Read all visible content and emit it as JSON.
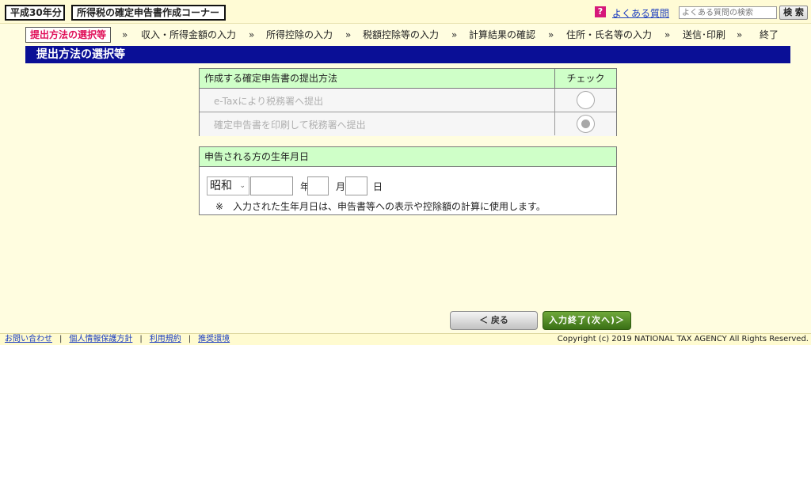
{
  "header": {
    "year_badge": "平成30年分",
    "corner_title": "所得税の確定申告書作成コーナー",
    "faq_icon": "?",
    "faq_link": "よくある質問",
    "faq_search_placeholder": "よくある質問の検索",
    "search_button": "検 索"
  },
  "steps": {
    "items": [
      {
        "label": "提出方法の選択等",
        "current": true
      },
      {
        "label": "収入・所得金額の入力"
      },
      {
        "label": "所得控除の入力"
      },
      {
        "label": "税額控除等の入力"
      },
      {
        "label": "計算結果の確認"
      },
      {
        "label": "住所・氏名等の入力"
      },
      {
        "label": "送信･印刷"
      },
      {
        "label": "終了"
      }
    ],
    "separator": "»"
  },
  "section_title": "提出方法の選択等",
  "submission": {
    "header": "作成する確定申告書の提出方法",
    "check_header": "チェック",
    "options": [
      {
        "label": "e-Taxにより税務署へ提出",
        "selected": false
      },
      {
        "label": "確定申告書を印刷して税務署へ提出",
        "selected": true
      }
    ]
  },
  "birth": {
    "header": "申告される方の生年月日",
    "era": "昭和",
    "year_value": "",
    "month_value": "",
    "day_value": "",
    "year_unit": "年",
    "month_unit": "月",
    "day_unit": "日",
    "note": "※　入力された生年月日は、申告書等への表示や控除額の計算に使用します。"
  },
  "buttons": {
    "back": "＜ 戻る",
    "next": "入力終了(次へ)＞"
  },
  "footer": {
    "links": [
      "お問い合わせ",
      "個人情報保護方針",
      "利用規約",
      "推奨環境"
    ],
    "separator": "|",
    "copyright": "Copyright (c) 2019 NATIONAL TAX AGENCY All Rights Reserved."
  },
  "colors": {
    "page_bg": "#fffde0",
    "title_bar": "#0a0f96",
    "table_header": "#cfffc8",
    "current_step": "#e0105a",
    "next_button": "#4f8a25"
  }
}
